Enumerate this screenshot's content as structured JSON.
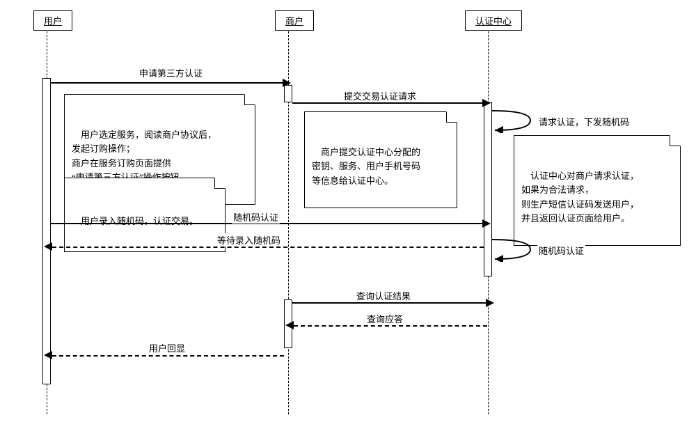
{
  "participants": {
    "user": "用户",
    "merchant": "商户",
    "auth_center": "认证中心"
  },
  "messages": {
    "m1": "申请第三方认证",
    "m2": "提交交易认证请求",
    "m3_self": "请求认证，下发随机码",
    "m4": "随机码认证",
    "m5": "等待录入随机码",
    "m6_self": "随机码认证",
    "m7": "查询认证结果",
    "m8": "查询应答",
    "m9": "用户回显"
  },
  "notes": {
    "n1": "用户选定服务，阅读商户协议后，\n发起订购操作；\n商户在服务订购页面提供\n“申请第三方认证”操作按钮。",
    "n2": "商户提交认证中心分配的\n密钥、服务、用户手机号码\n等信息给认证中心。",
    "n3": "认证中心对商户请求认证，\n如果为合法请求，\n则生产短信认证码发送用户，\n并且返回认证页面给用户。",
    "n4": "用户录入随机码，认证交易。"
  }
}
